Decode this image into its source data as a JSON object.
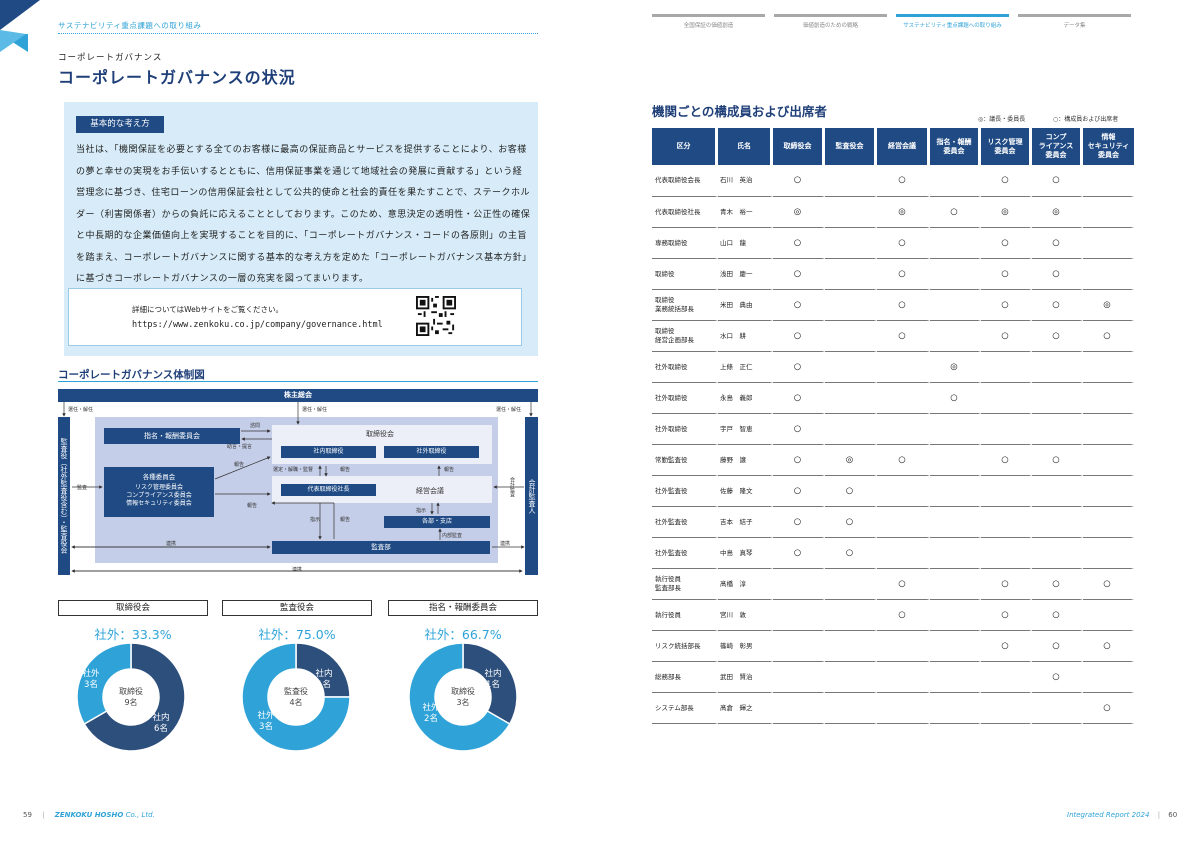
{
  "left_page": {
    "section_label": "サステナビリティ重点課題への取り組み",
    "kicker": "コーポレートガバナンス",
    "title": "コーポレートガバナンスの状況",
    "basic": {
      "tag": "基本的な考え方",
      "paragraph": "当社は、「機関保証を必要とする全てのお客様に最高の保証商品とサービスを提供することにより、お客様の夢と幸せの実現をお手伝いするとともに、信用保証事業を通じて地域社会の発展に貢献する」という経営理念に基づき、住宅ローンの信用保証会社として公共的使命と社会的責任を果たすことで、ステークホルダー（利害関係者）からの負託に応えることとしております。このため、意思決定の透明性・公正性の確保と中長期的な企業価値向上を実現することを目的に、「コーポレートガバナンス・コードの各原則」の主旨を踏まえ、コーポレートガバナンスに関する基本的な考え方を定めた「コーポレートガバナンス基本方針」に基づきコーポレートガバナンスの一層の充実を図ってまいります。",
      "web_note": "詳細についてはWebサイトをご覧ください。",
      "web_url": "https://www.zenkoku.co.jp/company/governance.html"
    },
    "diagram": {
      "title": "コーポレートガバナンス体制図",
      "shareholders": "株主総会",
      "appoint_left": "選任・解任",
      "appoint_mid": "選任・解任",
      "appoint_right": "選任・解任",
      "kansayaku": "監査役（社外監査役含む）・監査役会",
      "auditor": "会計監査人",
      "nomination": "指名・報酬委員会",
      "consult": "諮問",
      "advice": "助言・提言",
      "board": "取締役会",
      "internal_dir": "社内取締役",
      "external_dir": "社外取締役",
      "committees_title": "各種委員会",
      "committees": [
        "リスク管理委員会",
        "コンプライアンス委員会",
        "情報セキュリティ委員会"
      ],
      "report1": "報告",
      "report2": "報告",
      "report3": "報告",
      "report4": "報告",
      "report5": "報告",
      "supervise": "選定・解職・監督",
      "president": "代表取締役社長",
      "mgmt": "経営会議",
      "instruct1": "指示",
      "instruct2": "指示",
      "branches": "各部・支店",
      "internal_audit": "内部監査",
      "audit_dept": "監査部",
      "audit_label": "監査",
      "accounting_audit": "会計監査",
      "renkei1": "連携",
      "renkei2": "連携",
      "renkei3": "連携"
    },
    "pies": [
      {
        "name": "取締役会",
        "pct_label": "社外：33.3%",
        "center": "取締役\n9名",
        "seg_a": "社外\n3名",
        "seg_b": "社内\n6名",
        "outside": 3,
        "inside": 6
      },
      {
        "name": "監査役会",
        "pct_label": "社外：75.0%",
        "center": "監査役\n4名",
        "seg_a": "社内\n1名",
        "seg_b": "社外\n3名",
        "outside": 3,
        "inside": 1
      },
      {
        "name": "指名・報酬委員会",
        "pct_label": "社外：66.7%",
        "center": "取締役\n3名",
        "seg_a": "社内\n1名",
        "seg_b": "社外\n2名",
        "outside": 2,
        "inside": 1
      }
    ],
    "colors": {
      "inside": "#2d4f7c",
      "outside": "#2fa3d8",
      "navy": "#1f4a84"
    },
    "footer_page": "59",
    "footer_company_a": "ZENKOKU HOSHO",
    "footer_company_b": "Co., Ltd."
  },
  "right_page": {
    "nav": [
      "全国保証の価値創造",
      "価値創造のための戦略",
      "サステナビリティ重点課題への取り組み",
      "データ集"
    ],
    "nav_active": 2,
    "table_title": "機関ごとの構成員および出席者",
    "legend_chair": "◎：議長・委員長",
    "legend_member": "○：構成員および出席者",
    "headers": [
      "区分",
      "氏名",
      "取締役会",
      "監査役会",
      "経営会議",
      "指名・報酬\n委員会",
      "リスク管理\n委員会",
      "コンプ\nライアンス\n委員会",
      "情報\nセキュリティ\n委員会"
    ],
    "rows": [
      [
        "代表取締役会長",
        "石川　英治",
        "○",
        "",
        "○",
        "",
        "○",
        "○",
        ""
      ],
      [
        "代表取締役社長",
        "青木　裕一",
        "◎",
        "",
        "◎",
        "○",
        "◎",
        "◎",
        ""
      ],
      [
        "専務取締役",
        "山口　龍",
        "○",
        "",
        "○",
        "",
        "○",
        "○",
        ""
      ],
      [
        "取締役",
        "浅田　慶一",
        "○",
        "",
        "○",
        "",
        "○",
        "○",
        ""
      ],
      [
        "取締役\n業務統括部長",
        "米田　典由",
        "○",
        "",
        "○",
        "",
        "○",
        "○",
        "◎"
      ],
      [
        "取締役\n経営企画部長",
        "水口　耕",
        "○",
        "",
        "○",
        "",
        "○",
        "○",
        "○"
      ],
      [
        "社外取締役",
        "上條　正仁",
        "○",
        "",
        "",
        "◎",
        "",
        "",
        ""
      ],
      [
        "社外取締役",
        "永島　義郎",
        "○",
        "",
        "",
        "○",
        "",
        "",
        ""
      ],
      [
        "社外取締役",
        "宇戸　智恵",
        "○",
        "",
        "",
        "",
        "",
        "",
        ""
      ],
      [
        "常勤監査役",
        "藤野　譲",
        "○",
        "◎",
        "○",
        "",
        "○",
        "○",
        ""
      ],
      [
        "社外監査役",
        "佐藤　隆文",
        "○",
        "○",
        "",
        "",
        "",
        "",
        ""
      ],
      [
        "社外監査役",
        "吉本　結子",
        "○",
        "○",
        "",
        "",
        "",
        "",
        ""
      ],
      [
        "社外監査役",
        "中島　真琴",
        "○",
        "○",
        "",
        "",
        "",
        "",
        ""
      ],
      [
        "執行役員\n監査部長",
        "髙橋　淳",
        "",
        "",
        "○",
        "",
        "○",
        "○",
        "○"
      ],
      [
        "執行役員",
        "宮川　敦",
        "",
        "",
        "○",
        "",
        "○",
        "○",
        ""
      ],
      [
        "リスク統括部長",
        "篠崎　彰男",
        "",
        "",
        "",
        "",
        "○",
        "○",
        "○"
      ],
      [
        "総務部長",
        "武田　賢治",
        "",
        "",
        "",
        "",
        "",
        "○",
        ""
      ],
      [
        "システム部長",
        "髙倉　輝之",
        "",
        "",
        "",
        "",
        "",
        "",
        "○"
      ]
    ],
    "footer_report_a": "Integrated",
    "footer_report_b": "Report 2024",
    "footer_page": "60"
  }
}
